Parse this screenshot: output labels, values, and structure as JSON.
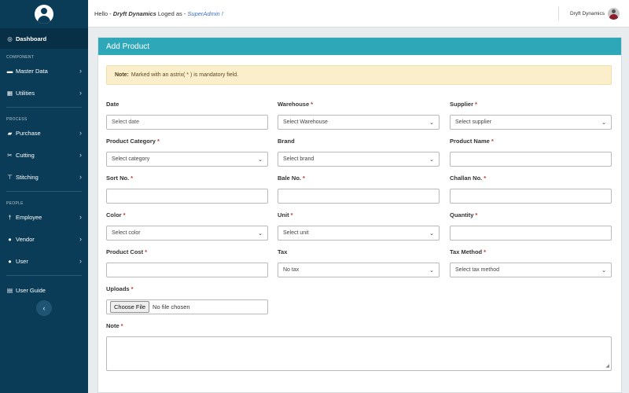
{
  "sidebar": {
    "items": [
      {
        "name": "sidebar-item-dashboard",
        "label": "Dashboard",
        "icon": "dashboard-icon",
        "glyph": "◎",
        "chevron": false,
        "active": true
      },
      {
        "section": "COMPONENT"
      },
      {
        "name": "sidebar-item-master-data",
        "label": "Master Data",
        "icon": "folder-icon",
        "glyph": "▬",
        "chevron": true
      },
      {
        "name": "sidebar-item-utilities",
        "label": "Utilities",
        "icon": "table-icon",
        "glyph": "▦",
        "chevron": true
      },
      {
        "divider": true
      },
      {
        "section": "PROCESS"
      },
      {
        "name": "sidebar-item-purchase",
        "label": "Purchase",
        "icon": "cart-icon",
        "glyph": "▰",
        "chevron": true
      },
      {
        "name": "sidebar-item-cutting",
        "label": "Cutting",
        "icon": "scissors-icon",
        "glyph": "✂",
        "chevron": true
      },
      {
        "name": "sidebar-item-stitching",
        "label": "Stitching",
        "icon": "pin-icon",
        "glyph": "⊤",
        "chevron": true
      },
      {
        "divider": true
      },
      {
        "section": "PEOPLE"
      },
      {
        "name": "sidebar-item-employee",
        "label": "Employee",
        "icon": "person-icon",
        "glyph": "†",
        "chevron": true
      },
      {
        "name": "sidebar-item-vendor",
        "label": "Vendor",
        "icon": "user-icon",
        "glyph": "●",
        "chevron": true
      },
      {
        "name": "sidebar-item-user",
        "label": "User",
        "icon": "users-icon",
        "glyph": "●",
        "chevron": true
      },
      {
        "divider": true
      },
      {
        "name": "sidebar-item-user-guide",
        "label": "User Guide",
        "icon": "book-icon",
        "glyph": "▤",
        "chevron": false
      }
    ],
    "collapse_glyph": "‹"
  },
  "header": {
    "hello": "Hello - ",
    "company": "Dryft Dynamics",
    "loged_as": " Loged as - ",
    "role": "SuperAdmin !",
    "user_name": "Dryft Dynamics"
  },
  "card": {
    "title": "Add Product",
    "note_label": "Note:",
    "note_text": "Marked with an astrix( * ) is mandatory field."
  },
  "fields": [
    {
      "name": "date",
      "label": "Date",
      "required": false,
      "type": "input",
      "placeholder": "Select date"
    },
    {
      "name": "warehouse",
      "label": "Warehouse",
      "required": true,
      "type": "select",
      "value": "Select Warehouse"
    },
    {
      "name": "supplier",
      "label": "Supplier",
      "required": true,
      "type": "select",
      "value": "Select supplier"
    },
    {
      "name": "product-category",
      "label": "Product Category",
      "required": true,
      "type": "select",
      "value": "Select category"
    },
    {
      "name": "brand",
      "label": "Brand",
      "required": false,
      "type": "select",
      "value": "Select brand"
    },
    {
      "name": "product-name",
      "label": "Product Name",
      "required": true,
      "type": "input",
      "placeholder": ""
    },
    {
      "name": "sort-no",
      "label": "Sort No.",
      "required": true,
      "type": "input",
      "placeholder": ""
    },
    {
      "name": "bale-no",
      "label": "Bale No.",
      "required": true,
      "type": "input",
      "placeholder": ""
    },
    {
      "name": "challan-no",
      "label": "Challan No.",
      "required": true,
      "type": "input",
      "placeholder": ""
    },
    {
      "name": "color",
      "label": "Color",
      "required": true,
      "type": "select",
      "value": "Select color"
    },
    {
      "name": "unit",
      "label": "Unit",
      "required": true,
      "type": "select",
      "value": "Select unit"
    },
    {
      "name": "quantity",
      "label": "Quantity",
      "required": true,
      "type": "input",
      "placeholder": ""
    },
    {
      "name": "product-cost",
      "label": "Product Cost",
      "required": true,
      "type": "input",
      "placeholder": ""
    },
    {
      "name": "tax",
      "label": "Tax",
      "required": false,
      "type": "select",
      "value": "No tax"
    },
    {
      "name": "tax-method",
      "label": "Tax Method",
      "required": true,
      "type": "select",
      "value": "Select tax method"
    }
  ],
  "uploads": {
    "label": "Uploads",
    "required": true,
    "button": "Choose File",
    "status": "No file chosen"
  },
  "note_field": {
    "label": "Note",
    "required": true,
    "value": ""
  },
  "required_mark": "*",
  "colors": {
    "sidebar": "#0a3c57",
    "header": "#2ea7b8",
    "note_bg": "#fbeecb",
    "required": "#c0392b"
  }
}
